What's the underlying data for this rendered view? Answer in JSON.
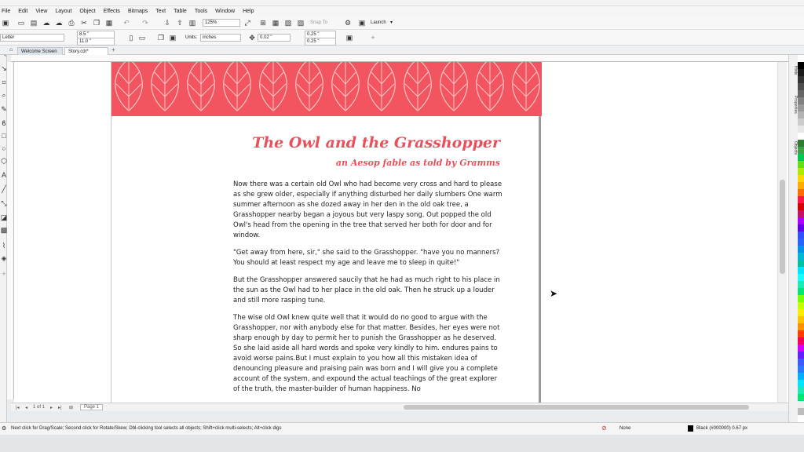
{
  "menu": [
    "File",
    "Edit",
    "View",
    "Layout",
    "Object",
    "Effects",
    "Bitmaps",
    "Text",
    "Table",
    "Tools",
    "Window",
    "Help"
  ],
  "toolbar": {
    "zoom_value": "125%",
    "snap_label": "Snap To",
    "launch_label": "Launch"
  },
  "property_bar": {
    "page_size": "Letter",
    "width": "8.5 \"",
    "height": "11.0 \"",
    "units_label": "Units:",
    "units_value": "inches",
    "nudge": "0.02 \"",
    "dup_x": "0.25 \"",
    "dup_y": "0.25 \""
  },
  "tabs": {
    "welcome": "Welcome Screen",
    "document": "Story.cdr*"
  },
  "story": {
    "title": "The Owl and the Grasshopper",
    "subtitle": "an Aesop fable as told by Gramms",
    "paragraphs": [
      "Now there was a certain old Owl who had become very cross and hard to please as she grew older, especially if anything disturbed her daily slumbers One warm summer afternoon as she dozed away in her den in the old oak tree, a Grasshopper nearby began a joyous but very laspy song. Out popped the old Owl's head from the opening in the tree that served her both for door and for window.",
      "\"Get away from here, sir,\" she said to the Grasshopper. \"have you no manners? You should at least respect my age and leave me to sleep in quite!\"",
      "But the Grasshopper answered saucily that he had as much right to his place in the sun as the Owl had to her place in the old oak. Then he struck up a louder and still more rasping tune.",
      "The wise old Owl knew quite well that it would do no good to argue with the Grasshopper, nor with anybody else for that matter. Besides, her eyes were not sharp enough by day to permit her to punish the Grasshopper as he deserved. So she laid aside all hard words and spoke very kindly to him. endures pains to avoid worse pains.But I must explain to you how all this mistaken idea of denouncing pleasure and praising pain was born and I will give you a complete account of the system, and expound the actual teachings of the great explorer of the truth, the master-builder of human happiness. No"
    ]
  },
  "page_nav": {
    "page_label": "Page 1"
  },
  "dockers": [
    "Hints",
    "Properties",
    "Objects"
  ],
  "status": {
    "hint": "Next click for Drag/Scale; Second click for Rotate/Skew; Dbl-clicking tool selects all objects; Shift+click multi-selects; Alt+click digs",
    "fill": "None",
    "outline": "Black (#000000)  0.67 px"
  },
  "colors": {
    "accent": "#f25560",
    "title_red": "#e8505b",
    "palette": [
      "#ffffff",
      "#000000",
      "#1a1a1a",
      "#333333",
      "#4d4d4d",
      "#666666",
      "#808080",
      "#999999",
      "#b3b3b3",
      "#cccccc",
      "#e6e6e6",
      "#ffffff",
      "#2e7d32",
      "#43a047",
      "#00c853",
      "#64dd17",
      "#aeea00",
      "#ffd600",
      "#ffab00",
      "#ff6d00",
      "#ff1744",
      "#d50000",
      "#c51162",
      "#aa00ff",
      "#6200ea",
      "#304ffe",
      "#2962ff",
      "#0091ea",
      "#00b8d4",
      "#00bfa5",
      "#00e5ff",
      "#18ffff",
      "#1de9b6",
      "#00e676",
      "#76ff03",
      "#c6ff00",
      "#ffea00",
      "#ffc400",
      "#ff9100",
      "#ff3d00",
      "#f50057",
      "#d500f9",
      "#651fff",
      "#3d5afe",
      "#2979ff",
      "#00b0ff",
      "#00e5ff",
      "#1de9b6",
      "#00e676",
      "#eeeeee",
      "#bdbdbd"
    ]
  }
}
